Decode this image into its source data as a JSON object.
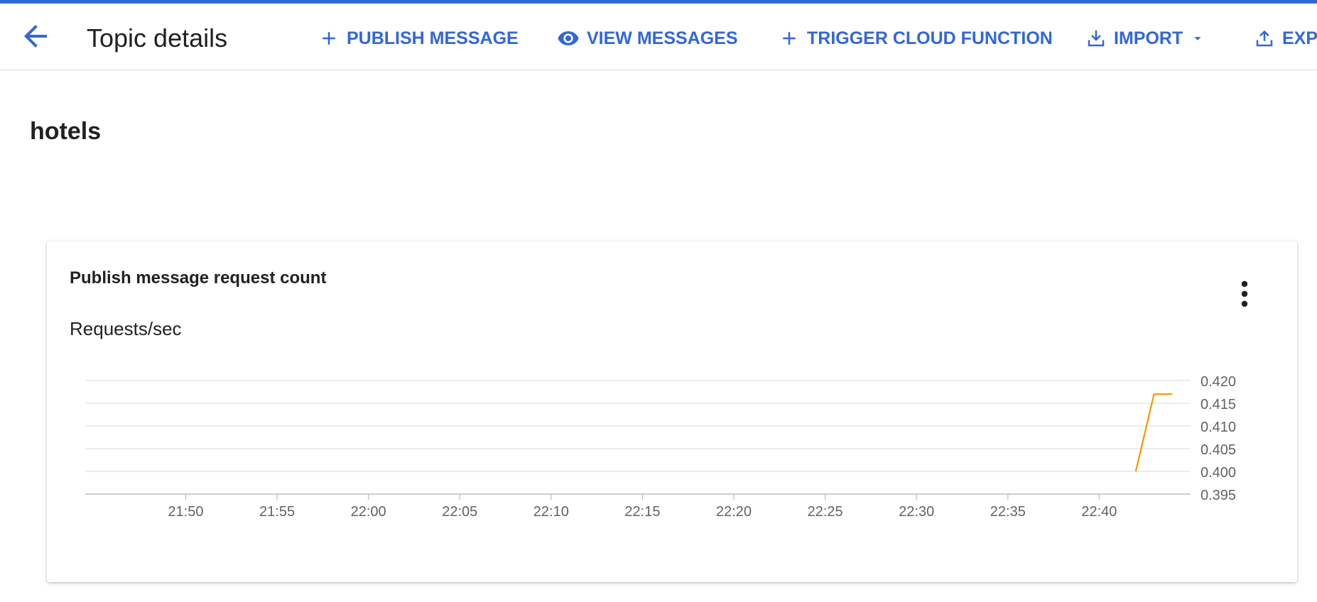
{
  "header": {
    "title": "Topic details",
    "actions": {
      "publish": "PUBLISH MESSAGE",
      "view": "VIEW MESSAGES",
      "trigger": "TRIGGER CLOUD FUNCTION",
      "import": "IMPORT",
      "export": "EXPO"
    },
    "accent_color": "#3367d6",
    "icons": {
      "back": "arrow-back-icon",
      "publish": "plus-icon",
      "view": "eye-icon",
      "trigger": "plus-icon",
      "import": "download-icon",
      "import_menu": "caret-down-icon",
      "export": "upload-icon"
    }
  },
  "topic": {
    "name": "hotels"
  },
  "card": {
    "title": "Publish message request count",
    "unit": "Requests/sec",
    "menu_icon": "more-vert-icon"
  },
  "chart_data": {
    "type": "line",
    "title": "",
    "ylabel": "Requests/sec",
    "xlabel": "",
    "x_ticks": [
      "21:50",
      "21:55",
      "22:00",
      "22:05",
      "22:10",
      "22:15",
      "22:20",
      "22:25",
      "22:30",
      "22:35",
      "22:40"
    ],
    "y_ticks": [
      "0.420",
      "0.415",
      "0.410",
      "0.405",
      "0.400",
      "0.395"
    ],
    "ylim": [
      0.395,
      0.42
    ],
    "xlim": [
      "21:44:30",
      "22:45"
    ],
    "grid": true,
    "legend": "none",
    "series": [
      {
        "color": "#f29900",
        "points": [
          {
            "x": "22:42",
            "y": 0.4
          },
          {
            "x": "22:43",
            "y": 0.417
          },
          {
            "x": "22:44",
            "y": 0.417
          }
        ]
      }
    ]
  }
}
